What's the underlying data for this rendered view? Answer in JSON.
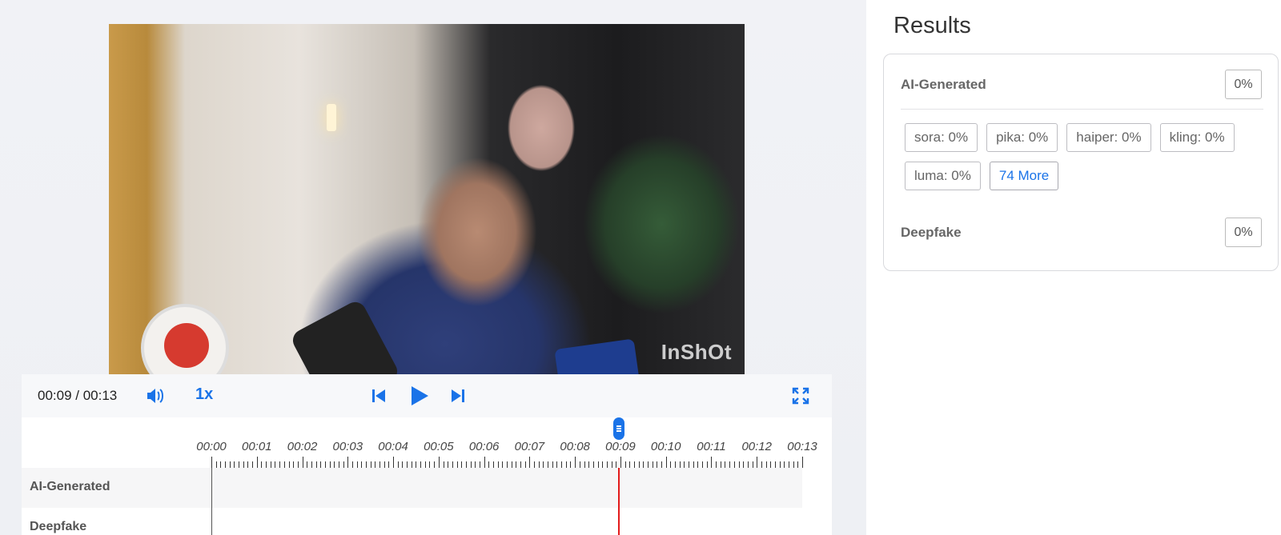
{
  "player": {
    "current_time": "00:09",
    "duration": "00:13",
    "time_display": "00:09 / 00:13",
    "speed": "1x",
    "playhead_position": 0.69,
    "watermark": "InShOt"
  },
  "timeline": {
    "ticks": [
      "00:00",
      "00:01",
      "00:02",
      "00:03",
      "00:04",
      "00:05",
      "00:06",
      "00:07",
      "00:08",
      "00:09",
      "00:10",
      "00:11",
      "00:12",
      "00:13"
    ],
    "tracks": [
      {
        "label": "AI-Generated"
      },
      {
        "label": "Deepfake"
      }
    ]
  },
  "results": {
    "title": "Results",
    "ai_generated": {
      "label": "AI-Generated",
      "percent": "0%",
      "models": [
        "sora: 0%",
        "pika: 0%",
        "haiper: 0%",
        "kling: 0%",
        "luma: 0%"
      ],
      "more_label": "74 More"
    },
    "deepfake": {
      "label": "Deepfake",
      "percent": "0%"
    }
  },
  "colors": {
    "accent": "#1a73e8",
    "playhead": "#e31b1b"
  }
}
